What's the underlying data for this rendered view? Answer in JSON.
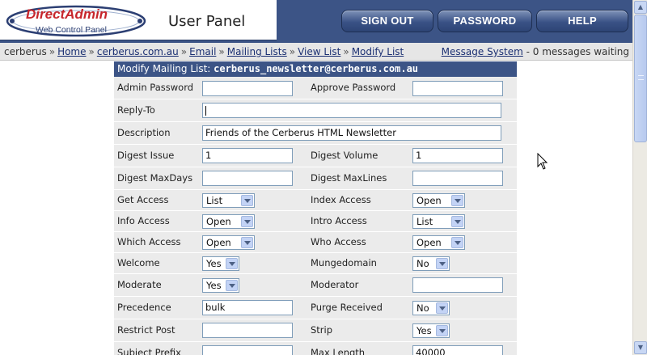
{
  "header": {
    "logo_text": "DirectAdmin",
    "logo_sub": "Web Control Panel",
    "title": "User Panel",
    "buttons": {
      "sign_out": "SIGN OUT",
      "password": "PASSWORD",
      "help": "HELP"
    }
  },
  "breadcrumb": {
    "user": "cerberus",
    "items": [
      "Home",
      "cerberus.com.au",
      "Email",
      "Mailing Lists",
      "View List",
      "Modify List"
    ],
    "separator": "»"
  },
  "messages": {
    "link": "Message System",
    "text": "- 0 messages waiting"
  },
  "form": {
    "title_prefix": "Modify Mailing List:",
    "list_address": "cerberus_newsletter@cerberus.com.au",
    "labels": {
      "admin_password": "Admin Password",
      "approve_password": "Approve Password",
      "reply_to": "Reply-To",
      "description": "Description",
      "digest_issue": "Digest Issue",
      "digest_volume": "Digest Volume",
      "digest_maxdays": "Digest MaxDays",
      "digest_maxlines": "Digest MaxLines",
      "get_access": "Get Access",
      "index_access": "Index Access",
      "info_access": "Info Access",
      "intro_access": "Intro Access",
      "which_access": "Which Access",
      "who_access": "Who Access",
      "welcome": "Welcome",
      "mungedomain": "Mungedomain",
      "moderate": "Moderate",
      "moderator": "Moderator",
      "precedence": "Precedence",
      "purge_received": "Purge Received",
      "restrict_post": "Restrict Post",
      "strip": "Strip",
      "subject_prefix": "Subject Prefix",
      "max_length": "Max Length"
    },
    "values": {
      "admin_password": "",
      "approve_password": "",
      "reply_to": "",
      "description": "Friends of the Cerberus HTML Newsletter",
      "digest_issue": "1",
      "digest_volume": "1",
      "digest_maxdays": "",
      "digest_maxlines": "",
      "get_access": "List",
      "index_access": "Open",
      "info_access": "Open",
      "intro_access": "List",
      "which_access": "Open",
      "who_access": "Open",
      "welcome": "Yes",
      "mungedomain": "No",
      "moderate": "Yes",
      "moderator": "",
      "precedence": "bulk",
      "purge_received": "No",
      "restrict_post": "",
      "strip": "Yes",
      "subject_prefix": "",
      "max_length": "40000"
    }
  },
  "colors": {
    "header_bg": "#3c5486",
    "row_bg": "#ebebeb",
    "link": "#1a2f72"
  }
}
